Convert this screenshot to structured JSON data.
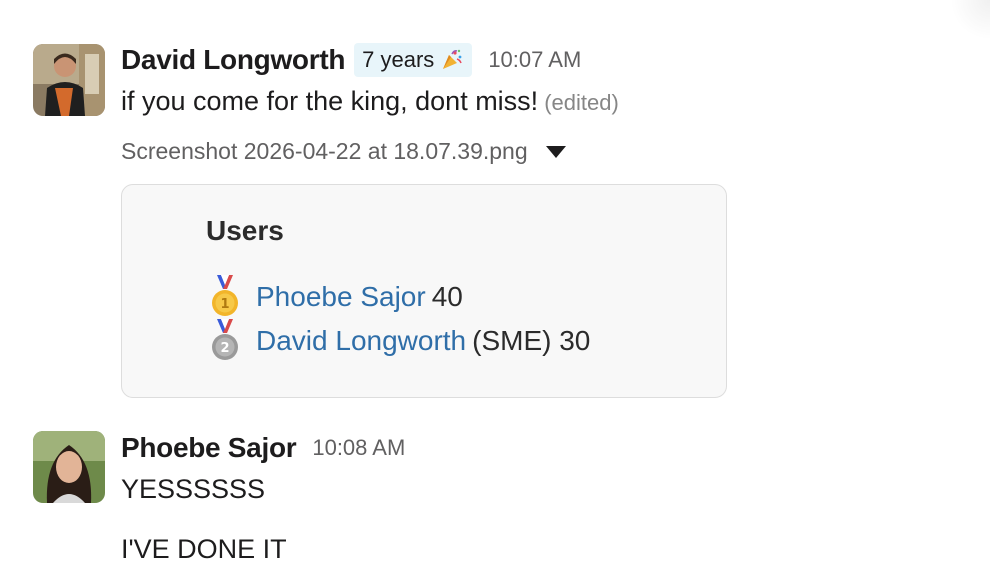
{
  "messages": [
    {
      "author": "David Longworth",
      "badge": "7 years",
      "badge_icon": "party-popper-icon",
      "time": "10:07 AM",
      "text": "if you come for the king, dont miss!",
      "edited": "(edited)",
      "file": {
        "name": "Screenshot 2026-04-22 at 18.07.39.png",
        "image": {
          "title": "Users",
          "entries": [
            {
              "rank_icon": "gold-medal-icon",
              "name": "Phoebe Sajor",
              "rest": "40"
            },
            {
              "rank_icon": "silver-medal-icon",
              "name": "David Longworth",
              "rest": "(SME) 30"
            }
          ]
        }
      }
    },
    {
      "author": "Phoebe Sajor",
      "time": "10:08 AM",
      "lines": [
        "YESSSSSS",
        "I'VE DONE IT"
      ]
    }
  ],
  "colors": {
    "link_blue": "#2f6ea8",
    "badge_bg": "#e8f5fa",
    "timestamp_grey": "#616061",
    "text": "#1d1c1d"
  }
}
